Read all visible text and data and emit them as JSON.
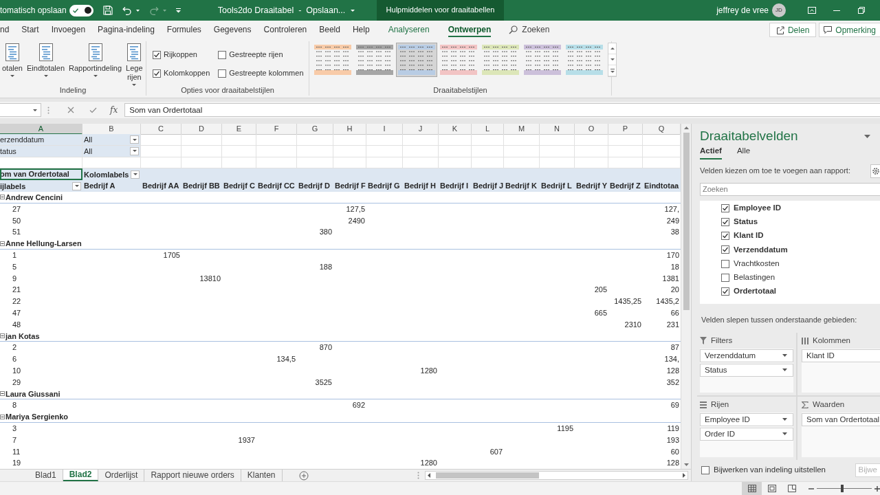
{
  "title_bar": {
    "autosave_label": "tomatisch opslaan",
    "autosave_on": true,
    "quick_access": [
      {
        "kind": "save",
        "disabled": false
      },
      {
        "kind": "undo",
        "disabled": false
      },
      {
        "kind": "redo",
        "disabled": true
      },
      {
        "kind": "customize",
        "disabled": false
      }
    ],
    "title": "Tools2do Draaitabel  -  Opslaan...",
    "context_label": "Hulpmiddelen voor draaitabellen",
    "user": "jeffrey de vree",
    "initials": "JD"
  },
  "ribbon": {
    "tabs": [
      {
        "label": "nd",
        "kind": "plain",
        "selected": false
      },
      {
        "label": "Start",
        "kind": "plain",
        "selected": false
      },
      {
        "label": "Invoegen",
        "kind": "plain",
        "selected": false
      },
      {
        "label": "Pagina-indeling",
        "kind": "plain",
        "selected": false
      },
      {
        "label": "Formules",
        "kind": "plain",
        "selected": false
      },
      {
        "label": "Gegevens",
        "kind": "plain",
        "selected": false
      },
      {
        "label": "Controleren",
        "kind": "plain",
        "selected": false
      },
      {
        "label": "Beeld",
        "kind": "plain",
        "selected": false
      },
      {
        "label": "Help",
        "kind": "plain",
        "selected": false
      },
      {
        "label": "Analyseren",
        "kind": "contextual",
        "selected": false
      },
      {
        "label": "Ontwerpen",
        "kind": "contextual",
        "selected": true
      }
    ],
    "search": "Zoeken",
    "share_button": "Delen",
    "comments_button": "Opmerking",
    "groups": [
      {
        "kind": "buttons",
        "label": "Indeling",
        "buttons": [
          {
            "label": "otalen",
            "dropdown": true
          },
          {
            "label": "Eindtotalen",
            "dropdown": true
          },
          {
            "label": "Rapportindeling",
            "dropdown": true
          },
          {
            "label": "Lege rijen",
            "dropdown": true
          }
        ]
      },
      {
        "kind": "options",
        "label": "Opties voor draaitabelstijlen",
        "options": [
          {
            "label": "Rijkoppen",
            "checked": true
          },
          {
            "label": "Kolomkoppen",
            "checked": true
          },
          {
            "label": "Gestreepte rijen",
            "checked": false
          },
          {
            "label": "Gestreepte kolommen",
            "checked": false
          }
        ]
      },
      {
        "kind": "gallery",
        "label": "Draaitabelstijlen",
        "styles": [
          {
            "color": "#f8cba8",
            "selected": false
          },
          {
            "color": "#a6a6a6",
            "selected": false
          },
          {
            "color": "#b8cce4",
            "selected": true
          },
          {
            "color": "#f2c4c4",
            "selected": false
          },
          {
            "color": "#dce6b8",
            "selected": false
          },
          {
            "color": "#ccc0da",
            "selected": false
          },
          {
            "color": "#b7dee8",
            "selected": false
          }
        ]
      }
    ]
  },
  "formula_bar": {
    "function_button": "fx",
    "formula": "Som van Ordertotaal"
  },
  "sheet": {
    "column_headers": [
      {
        "label": "A",
        "selected": true
      },
      {
        "label": "B",
        "selected": false
      },
      {
        "label": "C",
        "selected": false
      },
      {
        "label": "D",
        "selected": false
      },
      {
        "label": "E",
        "selected": false
      },
      {
        "label": "F",
        "selected": false
      },
      {
        "label": "G",
        "selected": false
      },
      {
        "label": "H",
        "selected": false
      },
      {
        "label": "I",
        "selected": false
      },
      {
        "label": "J",
        "selected": false
      },
      {
        "label": "K",
        "selected": false
      },
      {
        "label": "L",
        "selected": false
      },
      {
        "label": "M",
        "selected": false
      },
      {
        "label": "N",
        "selected": false
      },
      {
        "label": "O",
        "selected": false
      },
      {
        "label": "P",
        "selected": false
      },
      {
        "label": "Q",
        "selected": false
      }
    ],
    "filters": [
      {
        "field": "erzenddatum",
        "value": "All"
      },
      {
        "field": "tatus",
        "value": "All"
      }
    ],
    "pivot": {
      "values_field": {
        "label": "om van Ordertotaal",
        "selected": true
      },
      "column_labels": "Kolomlabels",
      "row_labels": "ijlabels",
      "columns": [
        "Bedrijf A",
        "Bedrijf AA",
        "Bedrijf BB",
        "Bedrijf C",
        "Bedrijf CC",
        "Bedrijf D",
        "Bedrijf F",
        "Bedrijf G",
        "Bedrijf H",
        "Bedrijf I",
        "Bedrijf J",
        "Bedrijf K",
        "Bedrijf L",
        "Bedrijf Y",
        "Bedrijf Z",
        "Eindtotaa"
      ],
      "rows": [
        {
          "label": "Andrew Cencini",
          "expanded": true,
          "children": [
            {
              "label": "27",
              "column_8": "127,5",
              "column_17": "127,"
            },
            {
              "label": "50",
              "column_8": "2490",
              "column_17": "249"
            },
            {
              "label": "51",
              "column_7": "380",
              "column_17": "38"
            }
          ]
        },
        {
          "label": "Anne Hellung-Larsen",
          "expanded": true,
          "children": [
            {
              "label": "1",
              "column_3": "1705",
              "column_17": "170"
            },
            {
              "label": "5",
              "column_7": "188",
              "column_17": "18"
            },
            {
              "label": "9",
              "column_4": "13810",
              "column_17": "1381"
            },
            {
              "label": "21",
              "column_15": "205",
              "column_17": "20"
            },
            {
              "label": "22",
              "column_16": "1435,25",
              "column_17": "1435,2"
            },
            {
              "label": "47",
              "column_15": "665",
              "column_17": "66"
            },
            {
              "label": "48",
              "column_16": "2310",
              "column_17": "231"
            }
          ]
        },
        {
          "label": "jan Kotas",
          "expanded": true,
          "children": [
            {
              "label": "2",
              "column_7": "870",
              "column_17": "87"
            },
            {
              "label": "6",
              "column_6": "134,5",
              "column_17": "134,"
            },
            {
              "label": "10",
              "column_10": "1280",
              "column_17": "128"
            },
            {
              "label": "29",
              "column_7": "3525",
              "column_17": "352"
            }
          ]
        },
        {
          "label": "Laura Giussani",
          "expanded": true,
          "children": [
            {
              "label": "8",
              "column_8": "692",
              "column_17": "69"
            }
          ]
        },
        {
          "label": "Mariya Sergienko",
          "expanded": true,
          "children": [
            {
              "label": "3",
              "column_14": "1195",
              "column_17": "119"
            },
            {
              "label": "7",
              "column_5": "1937",
              "column_17": "193"
            },
            {
              "label": "11",
              "column_12": "607",
              "column_17": "60"
            },
            {
              "label": "19",
              "column_10": "1280",
              "column_17": "128"
            }
          ]
        }
      ]
    }
  },
  "sheet_tabs": [
    {
      "label": "Blad1",
      "selected": false
    },
    {
      "label": "Blad2",
      "selected": true
    },
    {
      "label": "Orderlijst",
      "selected": false
    },
    {
      "label": "Rapport nieuwe orders",
      "selected": false
    },
    {
      "label": "Klanten",
      "selected": false
    }
  ],
  "field_panel": {
    "title": "Draaitabelvelden",
    "tabs": [
      {
        "label": "Actief",
        "selected": true
      },
      {
        "label": "Alle",
        "selected": false
      }
    ],
    "instruction": "Velden kiezen om toe te voegen aan rapport:",
    "search_placeholder": "Zoeken",
    "fields": [
      {
        "label": "Employee ID",
        "checked": true
      },
      {
        "label": "Status",
        "checked": true
      },
      {
        "label": "Klant ID",
        "checked": true
      },
      {
        "label": "Verzenddatum",
        "checked": true
      },
      {
        "label": "Vrachtkosten",
        "checked": false
      },
      {
        "label": "Belastingen",
        "checked": false
      },
      {
        "label": "Ordertotaal",
        "checked": true
      }
    ],
    "areas_instruction": "Velden slepen tussen onderstaande gebieden:",
    "areas": [
      {
        "kind": "filters",
        "label": "Filters",
        "items": [
          {
            "label": "Verzenddatum",
            "dropdown": true
          },
          {
            "label": "Status",
            "dropdown": true
          }
        ]
      },
      {
        "kind": "columns",
        "label": "Kolommen",
        "items": [
          {
            "label": "Klant ID"
          }
        ]
      },
      {
        "kind": "rows",
        "label": "Rijen",
        "items": [
          {
            "label": "Employee ID",
            "dropdown": true
          },
          {
            "label": "Order ID",
            "dropdown": true
          }
        ]
      },
      {
        "kind": "values",
        "label": "Waarden",
        "items": [
          {
            "label": "Som van Ordertotaal"
          }
        ]
      }
    ],
    "defer_update": {
      "label": "Bijwerken van indeling uitstellen",
      "checked": false
    },
    "update_button": {
      "label": "Bijwe",
      "disabled": true
    }
  },
  "status_bar": {
    "views": [
      {
        "kind": "normal",
        "selected": true
      },
      {
        "kind": "page_layout",
        "selected": false
      },
      {
        "kind": "page_break",
        "selected": false
      }
    ],
    "zoom": {
      "level": 0.46
    }
  }
}
